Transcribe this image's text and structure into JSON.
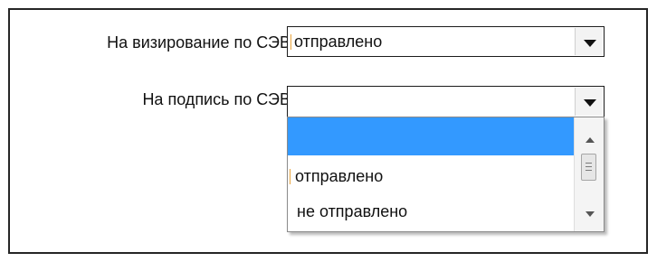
{
  "form": {
    "field1": {
      "label": "На визирование по СЭВ:",
      "value": "отправлено"
    },
    "field2": {
      "label": "На подпись по СЭВ:",
      "value": "",
      "expanded": true,
      "options": [
        "",
        "отправлено",
        "не отправлено"
      ],
      "highlighted_index": 0
    }
  },
  "icons": {
    "dropdown_arrow": "chevron-down-icon",
    "scroll_up": "scroll-up-icon",
    "scroll_down": "scroll-down-icon"
  },
  "colors": {
    "highlight": "#3399ff",
    "border": "#262626"
  }
}
